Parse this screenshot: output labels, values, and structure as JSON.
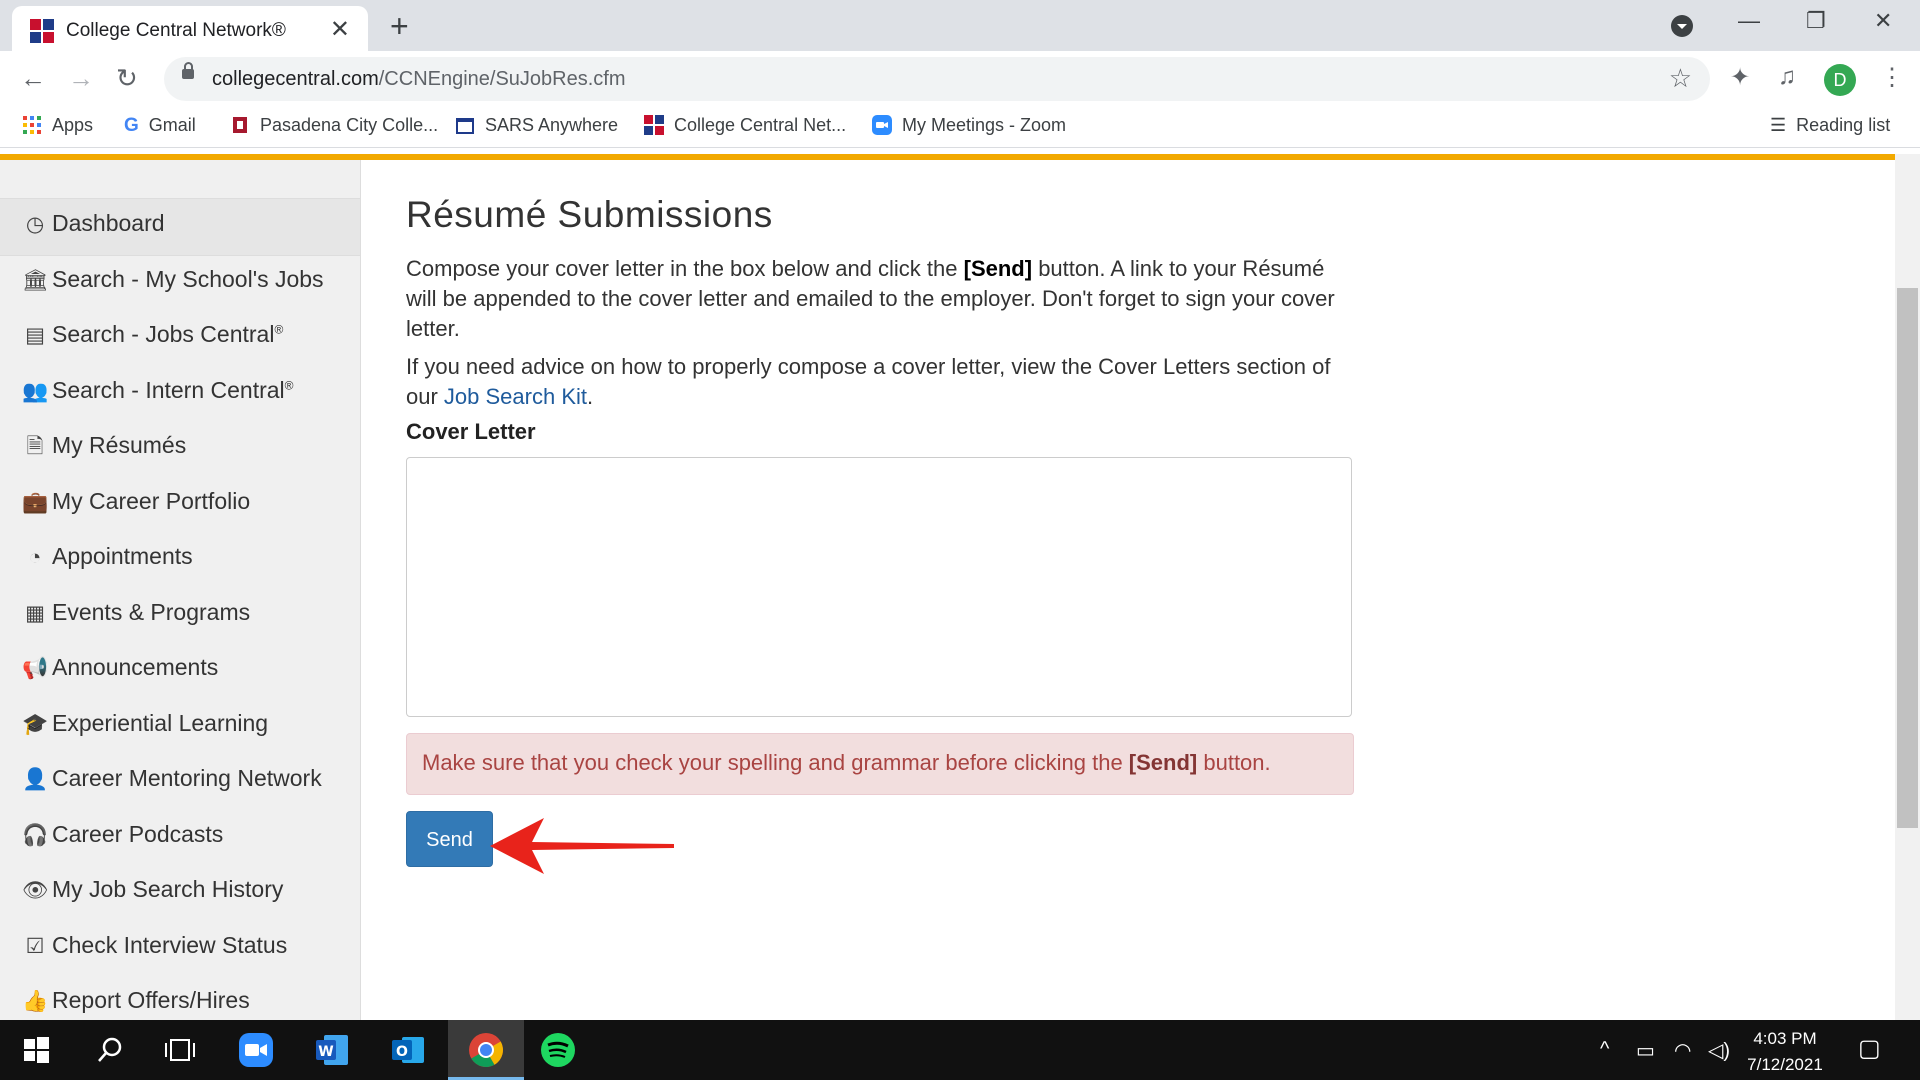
{
  "browser": {
    "tab_title": "College Central Network®",
    "url_domain": "collegecentral.com",
    "url_path": "/CCNEngine/SuJobRes.cfm",
    "profile_initial": "D",
    "bookmarks": [
      "Apps",
      "Gmail",
      "Pasadena City Colle...",
      "SARS Anywhere",
      "College Central Net...",
      "My Meetings - Zoom"
    ],
    "reading_list": "Reading list"
  },
  "sidebar": {
    "items": [
      {
        "label": "Dashboard",
        "icon": "dashboard-icon"
      },
      {
        "label": "Search - My School's Jobs",
        "icon": "building-icon"
      },
      {
        "label": "Search - Jobs Central",
        "sup": "®",
        "icon": "flag-icon"
      },
      {
        "label": "Search - Intern Central",
        "sup": "®",
        "icon": "users-icon"
      },
      {
        "label": "My Résumés",
        "icon": "document-icon"
      },
      {
        "label": "My Career Portfolio",
        "icon": "briefcase-icon"
      },
      {
        "label": "Appointments",
        "icon": "clock-icon"
      },
      {
        "label": "Events & Programs",
        "icon": "calendar-icon"
      },
      {
        "label": "Announcements",
        "icon": "megaphone-icon"
      },
      {
        "label": "Experiential Learning",
        "icon": "graduation-cap-icon"
      },
      {
        "label": "Career Mentoring Network",
        "icon": "user-icon"
      },
      {
        "label": "Career Podcasts",
        "icon": "headphones-icon"
      },
      {
        "label": "My Job Search History",
        "icon": "eye-icon"
      },
      {
        "label": "Check Interview Status",
        "icon": "check-square-icon"
      },
      {
        "label": "Report Offers/Hires",
        "icon": "thumbs-up-icon"
      }
    ]
  },
  "main": {
    "title": "Résumé Submissions",
    "para1_a": "Compose your cover letter in the box below and click the ",
    "para1_b": "[Send]",
    "para1_c": " button. A link to your Résumé will be appended to the cover letter and emailed to the employer. Don't forget to sign your cover letter.",
    "para2_a": "If you need advice on how to properly compose a cover letter, view the Cover Letters section of our ",
    "para2_link": "Job Search Kit",
    "para2_c": ".",
    "cover_label": "Cover Letter",
    "cover_value": "",
    "alert_a": "Make sure that you check your spelling and grammar before clicking the ",
    "alert_b": "[Send]",
    "alert_c": " button.",
    "send_label": "Send"
  },
  "taskbar": {
    "time": "4:03 PM",
    "date": "7/12/2021"
  },
  "colors": {
    "accent": "#f2a900",
    "button": "#337ab7",
    "alert_bg": "#f2dede",
    "arrow": "#e8231b"
  }
}
